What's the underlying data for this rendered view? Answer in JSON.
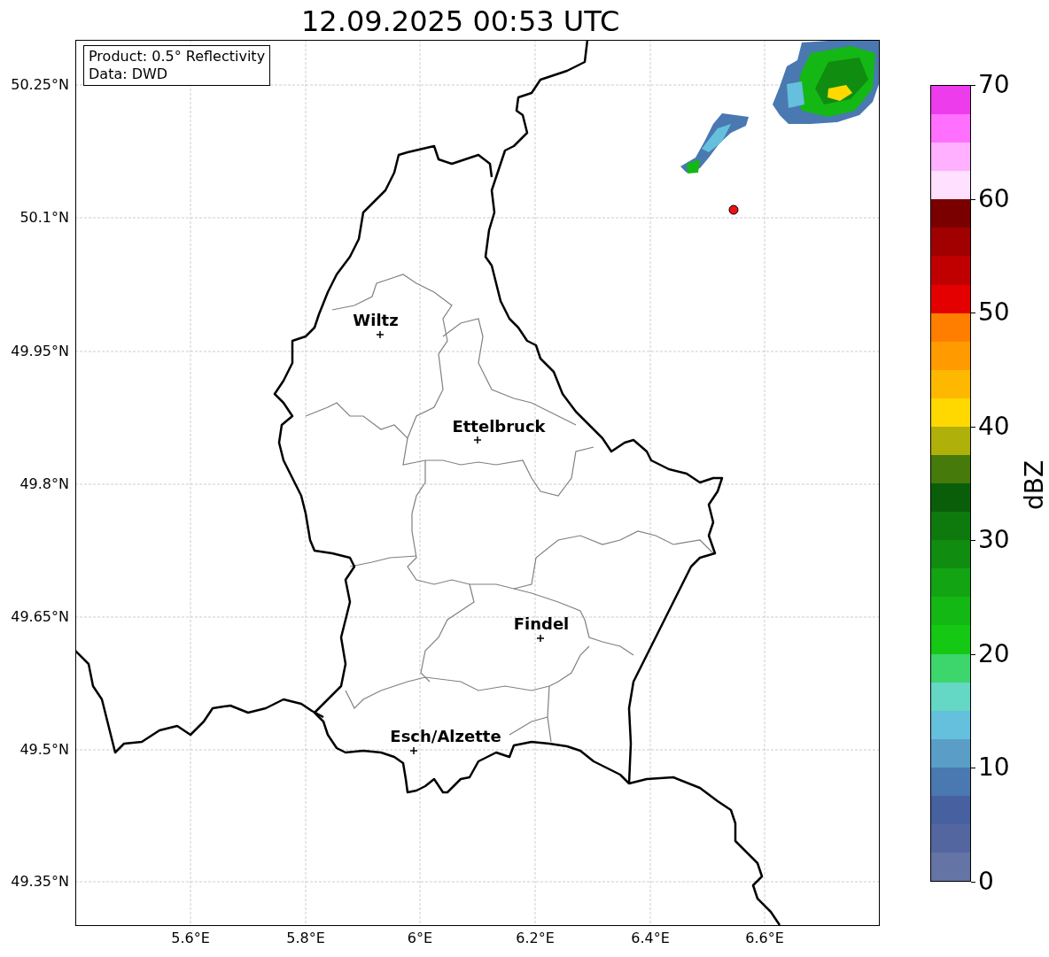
{
  "title": "12.09.2025 00:53 UTC",
  "info_box": [
    "Product: 0.5° Reflectivity",
    "Data: DWD"
  ],
  "y_ticks": [
    "50.25°N",
    "50.1°N",
    "49.95°N",
    "49.8°N",
    "49.65°N",
    "49.5°N",
    "49.35°N"
  ],
  "x_ticks": [
    "5.6°E",
    "5.8°E",
    "6°E",
    "6.2°E",
    "6.4°E",
    "6.6°E"
  ],
  "cities": [
    {
      "name": "Wiltz"
    },
    {
      "name": "Ettelbruck"
    },
    {
      "name": "Findel"
    },
    {
      "name": "Esch/Alzette"
    }
  ],
  "colorbar": {
    "label": "dBZ",
    "ticks": [
      "70",
      "60",
      "50",
      "40",
      "30",
      "20",
      "10",
      "0"
    ],
    "bands": [
      {
        "color": "#ec3cec"
      },
      {
        "color": "#ff70ff"
      },
      {
        "color": "#ffb0ff"
      },
      {
        "color": "#ffe0ff"
      },
      {
        "color": "#7a0000"
      },
      {
        "color": "#a00000"
      },
      {
        "color": "#c00000"
      },
      {
        "color": "#e40000"
      },
      {
        "color": "#ff7e00"
      },
      {
        "color": "#ff9a00"
      },
      {
        "color": "#ffb800"
      },
      {
        "color": "#ffd800"
      },
      {
        "color": "#b0b00a"
      },
      {
        "color": "#467a0a"
      },
      {
        "color": "#0a5e0a"
      },
      {
        "color": "#0e7a0e"
      },
      {
        "color": "#108c10"
      },
      {
        "color": "#12a412"
      },
      {
        "color": "#14b814"
      },
      {
        "color": "#14c814"
      },
      {
        "color": "#3cd66c"
      },
      {
        "color": "#64d8c4"
      },
      {
        "color": "#64c0dc"
      },
      {
        "color": "#5a9ec8"
      },
      {
        "color": "#4a78b0"
      },
      {
        "color": "#4660a0"
      },
      {
        "color": "#5466a0"
      },
      {
        "color": "#6474a4"
      }
    ]
  }
}
